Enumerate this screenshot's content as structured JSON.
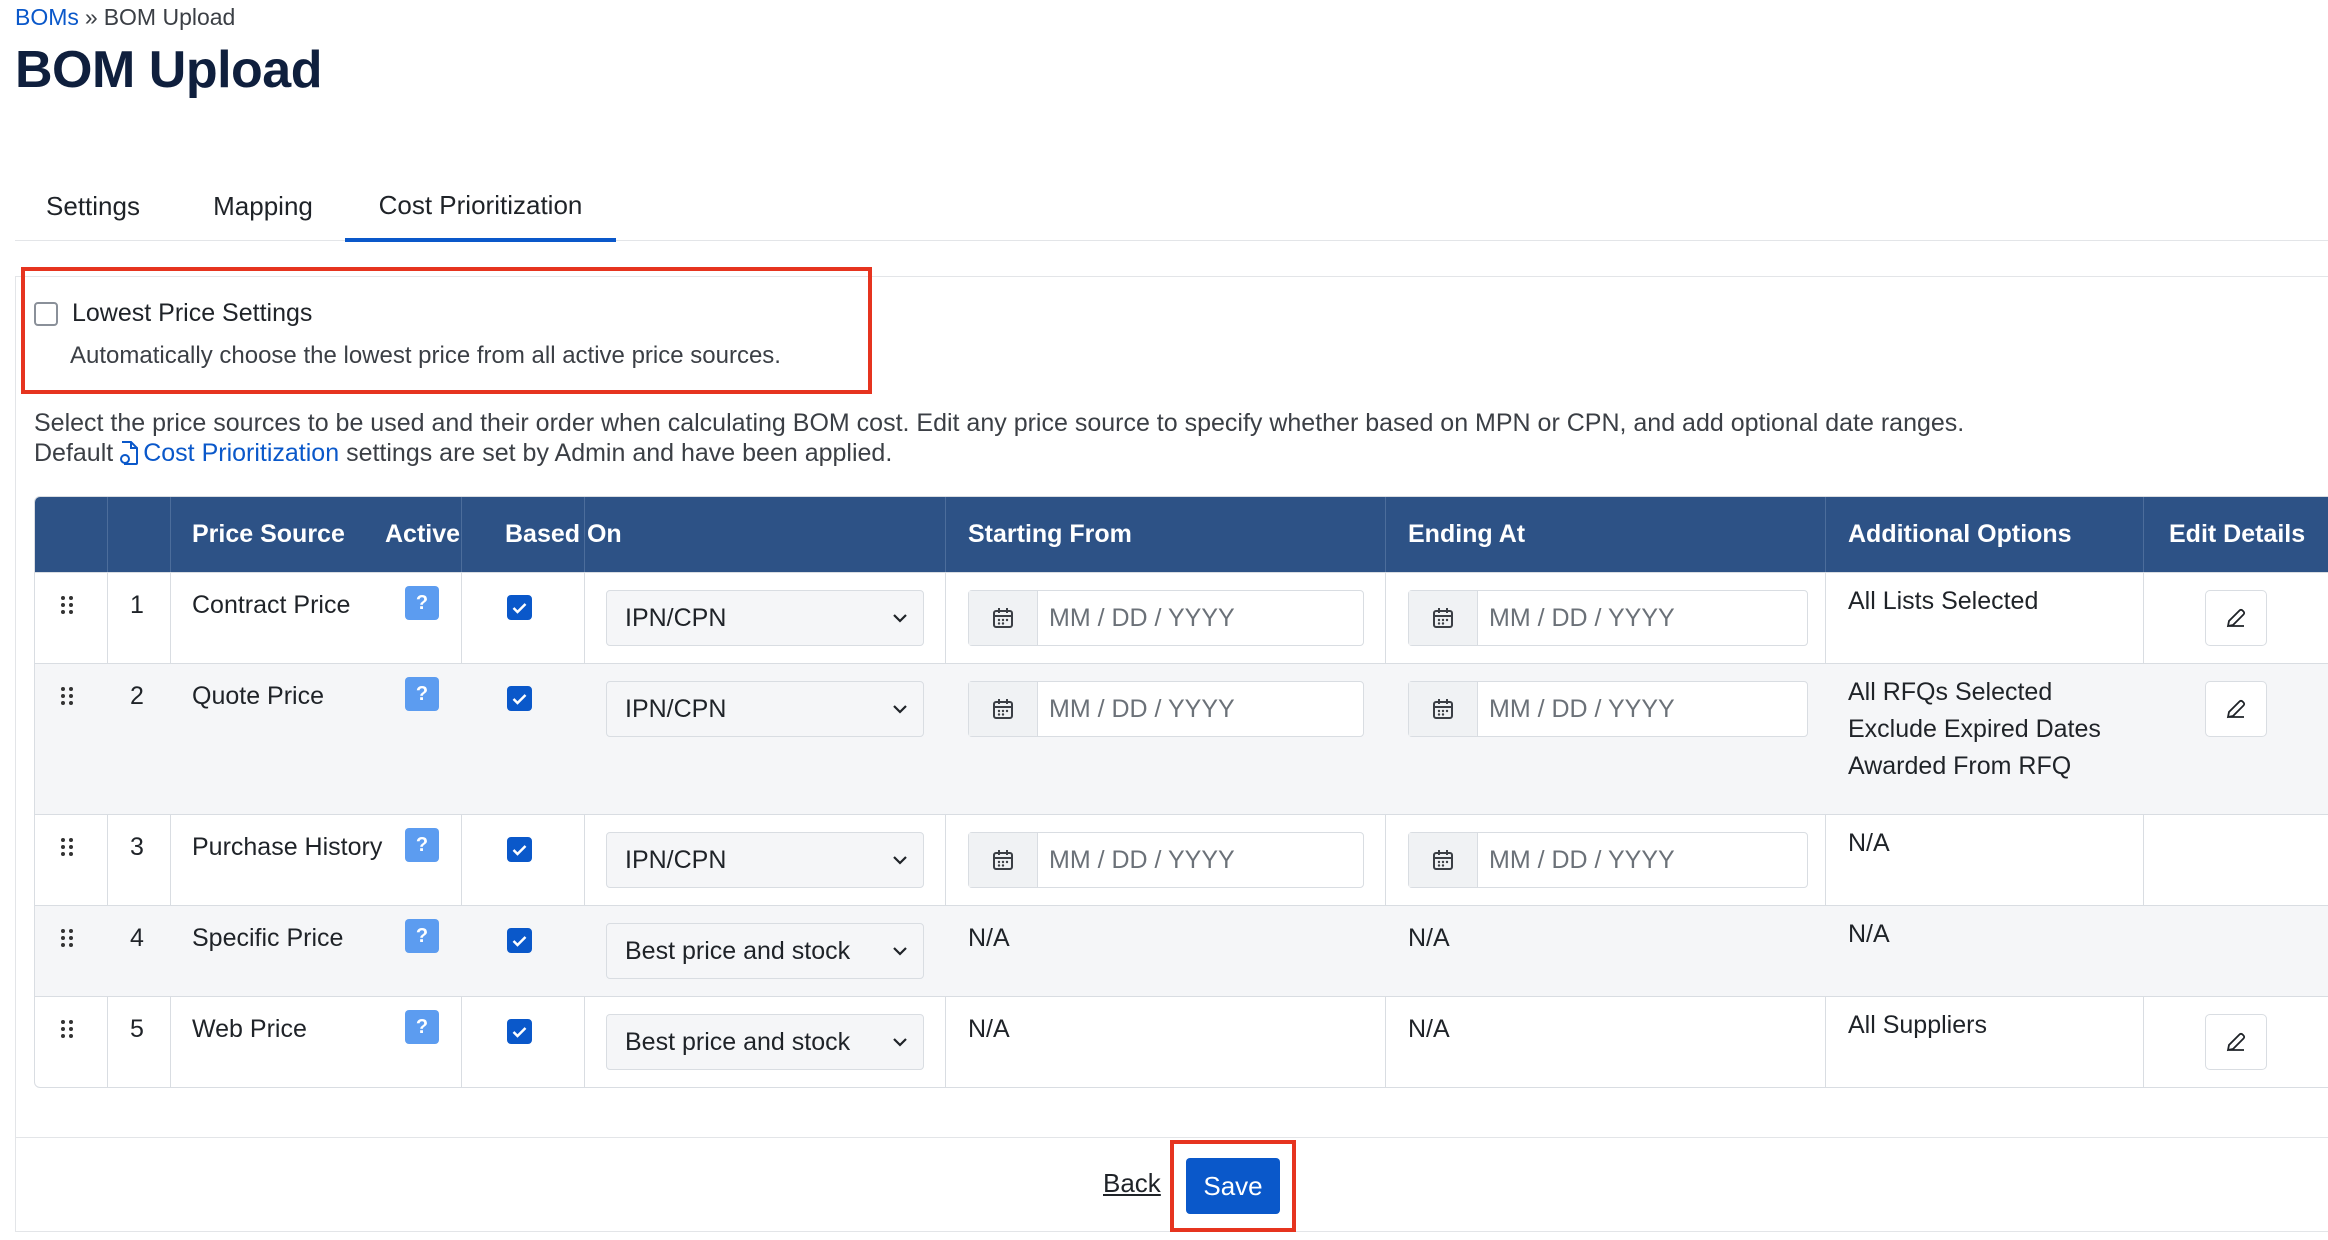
{
  "breadcrumb": {
    "root": "BOMs",
    "separator": "»",
    "current": "BOM Upload"
  },
  "page": {
    "title": "BOM Upload"
  },
  "tabs": {
    "settings": "Settings",
    "mapping": "Mapping",
    "cost": "Cost Prioritization",
    "active": "Cost Prioritization"
  },
  "lowest_price": {
    "title": "Lowest Price Settings",
    "description": "Automatically choose the lowest price from all active price sources.",
    "checked": false
  },
  "intro": {
    "line1": "Select the price sources to be used and their order when calculating BOM cost. Edit any price source to specify whether based on MPN or CPN, and add optional date ranges.",
    "line2_prefix": "Default",
    "line2_link": "Cost Prioritization",
    "line2_suffix": "settings are set by Admin and have been applied."
  },
  "table": {
    "headers": {
      "price_source": "Price Source",
      "active": "Active",
      "based_on": "Based On",
      "starting_from": "Starting From",
      "ending_at": "Ending At",
      "additional_options": "Additional Options",
      "edit_details": "Edit Details"
    },
    "help_glyph": "?",
    "date_placeholder": "MM / DD / YYYY",
    "rows": [
      {
        "num": "1",
        "source": "Contract Price",
        "active": true,
        "based_on": "IPN/CPN",
        "start": "",
        "end": "",
        "start_na": "",
        "end_na": "",
        "options": [
          "All Lists Selected"
        ],
        "editable": true
      },
      {
        "num": "2",
        "source": "Quote Price",
        "active": true,
        "based_on": "IPN/CPN",
        "start": "",
        "end": "",
        "start_na": "",
        "end_na": "",
        "options": [
          "All RFQs Selected",
          "Exclude Expired Dates",
          "Awarded From RFQ"
        ],
        "editable": true
      },
      {
        "num": "3",
        "source": "Purchase History",
        "active": true,
        "based_on": "IPN/CPN",
        "start": "",
        "end": "",
        "start_na": "",
        "end_na": "",
        "options": [
          "N/A"
        ],
        "editable": false
      },
      {
        "num": "4",
        "source": "Specific Price",
        "active": true,
        "based_on": "Best price and stock",
        "start_na": "N/A",
        "end_na": "N/A",
        "options": [
          "N/A"
        ],
        "editable": false
      },
      {
        "num": "5",
        "source": "Web Price",
        "active": true,
        "based_on": "Best price and stock",
        "start_na": "N/A",
        "end_na": "N/A",
        "options": [
          "All Suppliers"
        ],
        "editable": true
      }
    ]
  },
  "footer": {
    "back": "Back",
    "save": "Save"
  },
  "colors": {
    "accent": "#0a58ca",
    "table_header": "#2d5286",
    "highlight": "#e6341f",
    "help_badge": "#5c9cf0"
  }
}
